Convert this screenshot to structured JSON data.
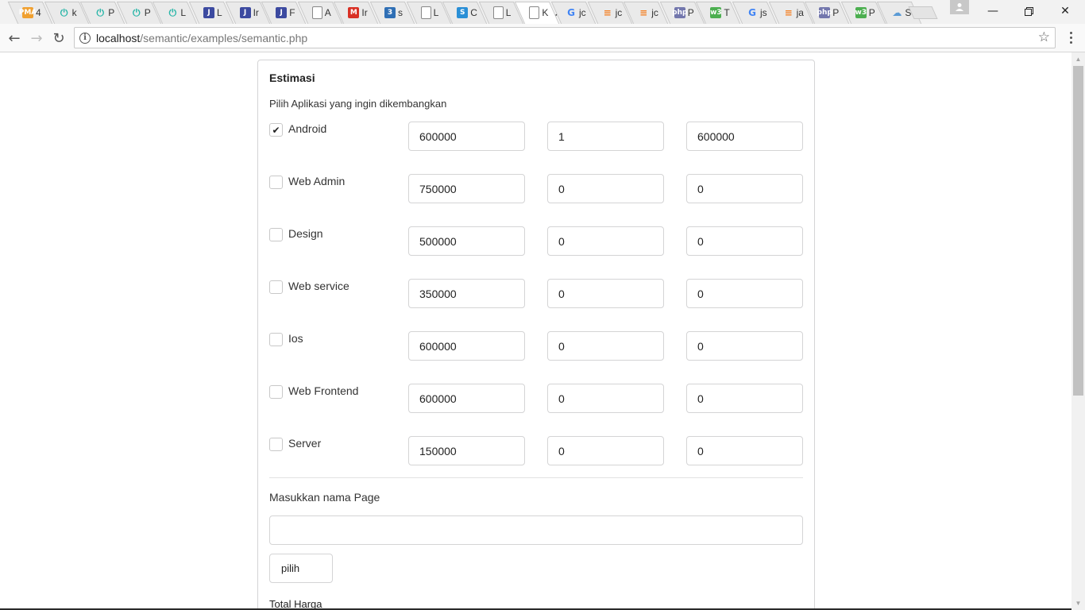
{
  "browser": {
    "tabs": [
      {
        "label": "4",
        "icon": "pma",
        "color": "#f0a030"
      },
      {
        "label": "k",
        "icon": "power",
        "color": "#29b6a8"
      },
      {
        "label": "P",
        "icon": "power",
        "color": "#29b6a8"
      },
      {
        "label": "P",
        "icon": "power",
        "color": "#29b6a8"
      },
      {
        "label": "L",
        "icon": "power",
        "color": "#29b6a8"
      },
      {
        "label": "L",
        "icon": "J",
        "color": "#3c4aa0"
      },
      {
        "label": "Ir",
        "icon": "J",
        "color": "#3c4aa0"
      },
      {
        "label": "F",
        "icon": "J",
        "color": "#3c4aa0"
      },
      {
        "label": "A",
        "icon": "doc",
        "color": "#888888"
      },
      {
        "label": "Ir",
        "icon": "M",
        "color": "#d93025"
      },
      {
        "label": "s",
        "icon": "css",
        "color": "#2f6fb5"
      },
      {
        "label": "L",
        "icon": "doc",
        "color": "#888888"
      },
      {
        "label": "C",
        "icon": "S",
        "color": "#2a8fd6"
      },
      {
        "label": "L",
        "icon": "doc",
        "color": "#888888"
      },
      {
        "label": "K",
        "icon": "doc",
        "color": "#888888",
        "active": true
      },
      {
        "label": "jc",
        "icon": "G",
        "color": "#4285f4"
      },
      {
        "label": "jc",
        "icon": "so",
        "color": "#f48024"
      },
      {
        "label": "jc",
        "icon": "so",
        "color": "#f48024"
      },
      {
        "label": "P",
        "icon": "php",
        "color": "#7377ad"
      },
      {
        "label": "T",
        "icon": "w3",
        "color": "#4caf50"
      },
      {
        "label": "js",
        "icon": "G",
        "color": "#4285f4"
      },
      {
        "label": "ja",
        "icon": "so",
        "color": "#f48024"
      },
      {
        "label": "P",
        "icon": "php",
        "color": "#7377ad"
      },
      {
        "label": "P",
        "icon": "w3",
        "color": "#4caf50"
      },
      {
        "label": "S",
        "icon": "cloud",
        "color": "#5b9bd5"
      }
    ],
    "url_host": "localhost",
    "url_path": "/semantic/examples/semantic.php"
  },
  "form": {
    "title": "Estimasi",
    "subtitle": "Pilih Aplikasi yang ingin dikembangkan",
    "rows": [
      {
        "label": "Android",
        "checked": true,
        "price": "600000",
        "qty": "1",
        "total": "600000"
      },
      {
        "label": "Web Admin",
        "checked": false,
        "price": "750000",
        "qty": "0",
        "total": "0"
      },
      {
        "label": "Design",
        "checked": false,
        "price": "500000",
        "qty": "0",
        "total": "0"
      },
      {
        "label": "Web service",
        "checked": false,
        "price": "350000",
        "qty": "0",
        "total": "0"
      },
      {
        "label": "Ios",
        "checked": false,
        "price": "600000",
        "qty": "0",
        "total": "0"
      },
      {
        "label": "Web Frontend",
        "checked": false,
        "price": "600000",
        "qty": "0",
        "total": "0"
      },
      {
        "label": "Server",
        "checked": false,
        "price": "150000",
        "qty": "0",
        "total": "0"
      }
    ],
    "page_label": "Masukkan nama Page",
    "page_value": "",
    "button_label": "pilih",
    "total_label": "Total Harga"
  }
}
